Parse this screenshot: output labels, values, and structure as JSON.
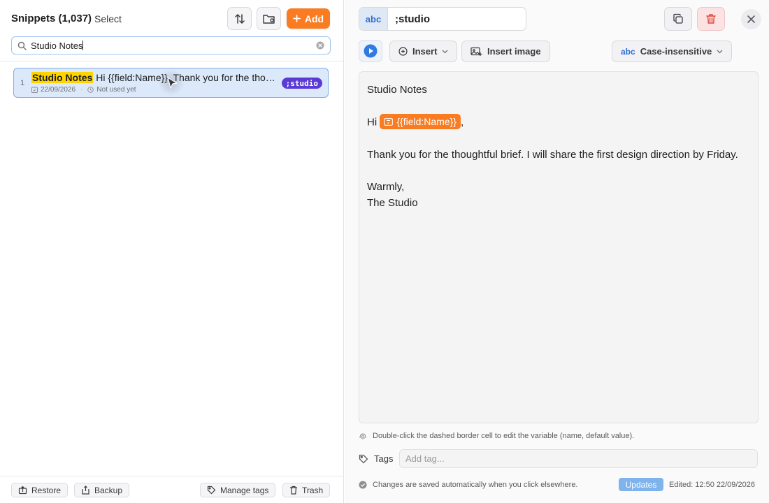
{
  "colors": {
    "accent": "#f97b22",
    "selection": "#dbe9fb",
    "highlight": "#ffd400",
    "badge": "#5b3bd6",
    "link_blue": "#2f6fd1"
  },
  "list": {
    "title": "Snippets (1,037)",
    "select_label": "Select",
    "sort_icon": "sort-arrows-icon",
    "folder_icon": "folder-settings-icon",
    "add_label": "Add",
    "search": {
      "value": "Studio Notes",
      "icon": "search-icon",
      "clear_icon": "clear-circle-icon"
    },
    "items": [
      {
        "index": "1",
        "title": "Studio Notes",
        "preview": " Hi {{field:Name}}, Thank you for the thoughtful brief. I will share the first design direction by Friday.",
        "date": "22/09/2026",
        "usage": "Not used yet",
        "abbreviation": ";studio"
      }
    ],
    "bottom": {
      "restore": "Restore",
      "backup": "Backup",
      "manage_tags": "Manage tags",
      "trash": "Trash"
    }
  },
  "editor": {
    "abbr_tag": "abc",
    "abbreviation": ";studio",
    "insert_label": "Insert",
    "insert_image_label": "Insert image",
    "case_tag": "abc",
    "case_label": "Case-insensitive",
    "content": {
      "line1": "Studio Notes",
      "greeting_prefix": "Hi ",
      "variable": "{{field:Name}}",
      "greeting_suffix": ",",
      "body": "Thank you for the thoughtful brief. I will share the first design direction by Friday.",
      "signoff": "Warmly,",
      "signature": "The Studio"
    },
    "hint": "Double-click the dashed border cell to edit the variable (name, default value).",
    "tags_label": "Tags",
    "tags_placeholder": "Add tag...",
    "footer_note": "Changes are saved automatically when you click elsewhere.",
    "updates_label": "Updates",
    "edited": "Edited: 12:50 22/09/2026"
  }
}
